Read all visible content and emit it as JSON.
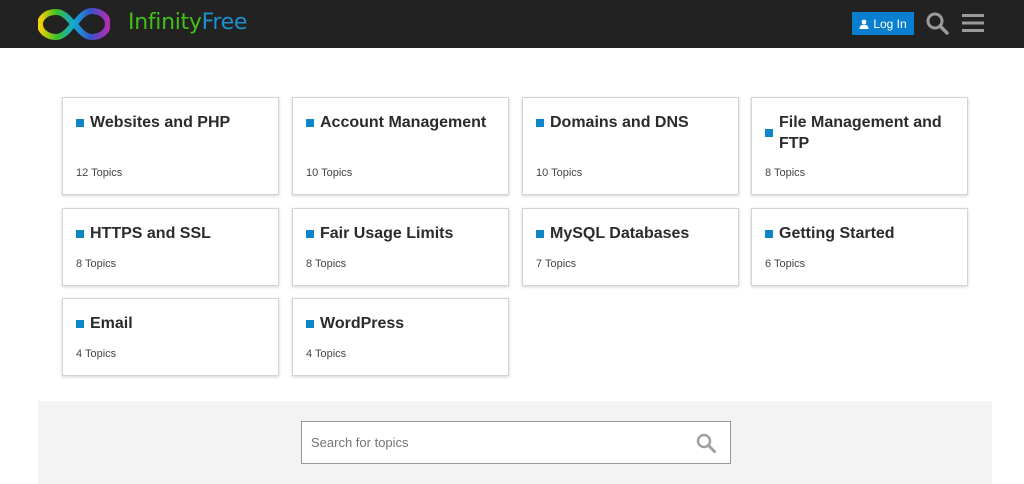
{
  "header": {
    "brand_part1": "Infinity",
    "brand_part2": "Free",
    "login_label": "Log In",
    "icons": {
      "search": "search-icon",
      "menu": "hamburger-menu-icon",
      "user": "user-icon"
    },
    "colors": {
      "background": "#222222",
      "brand_green": "#43c018",
      "brand_blue": "#1d8fce",
      "login_button": "#0a7ecf"
    }
  },
  "categories": [
    {
      "title": "Websites and PHP",
      "count": "12 Topics"
    },
    {
      "title": "Account Management",
      "count": "10 Topics"
    },
    {
      "title": "Domains and DNS",
      "count": "10 Topics"
    },
    {
      "title": "File Management and FTP",
      "count": "8 Topics"
    },
    {
      "title": "HTTPS and SSL",
      "count": "8 Topics"
    },
    {
      "title": "Fair Usage Limits",
      "count": "8 Topics"
    },
    {
      "title": "MySQL Databases",
      "count": "7 Topics"
    },
    {
      "title": "Getting Started",
      "count": "6 Topics"
    },
    {
      "title": "Email",
      "count": "4 Topics"
    },
    {
      "title": "WordPress",
      "count": "4 Topics"
    }
  ],
  "category_color": "#0a86c9",
  "search": {
    "placeholder": "Search for topics",
    "value": ""
  }
}
